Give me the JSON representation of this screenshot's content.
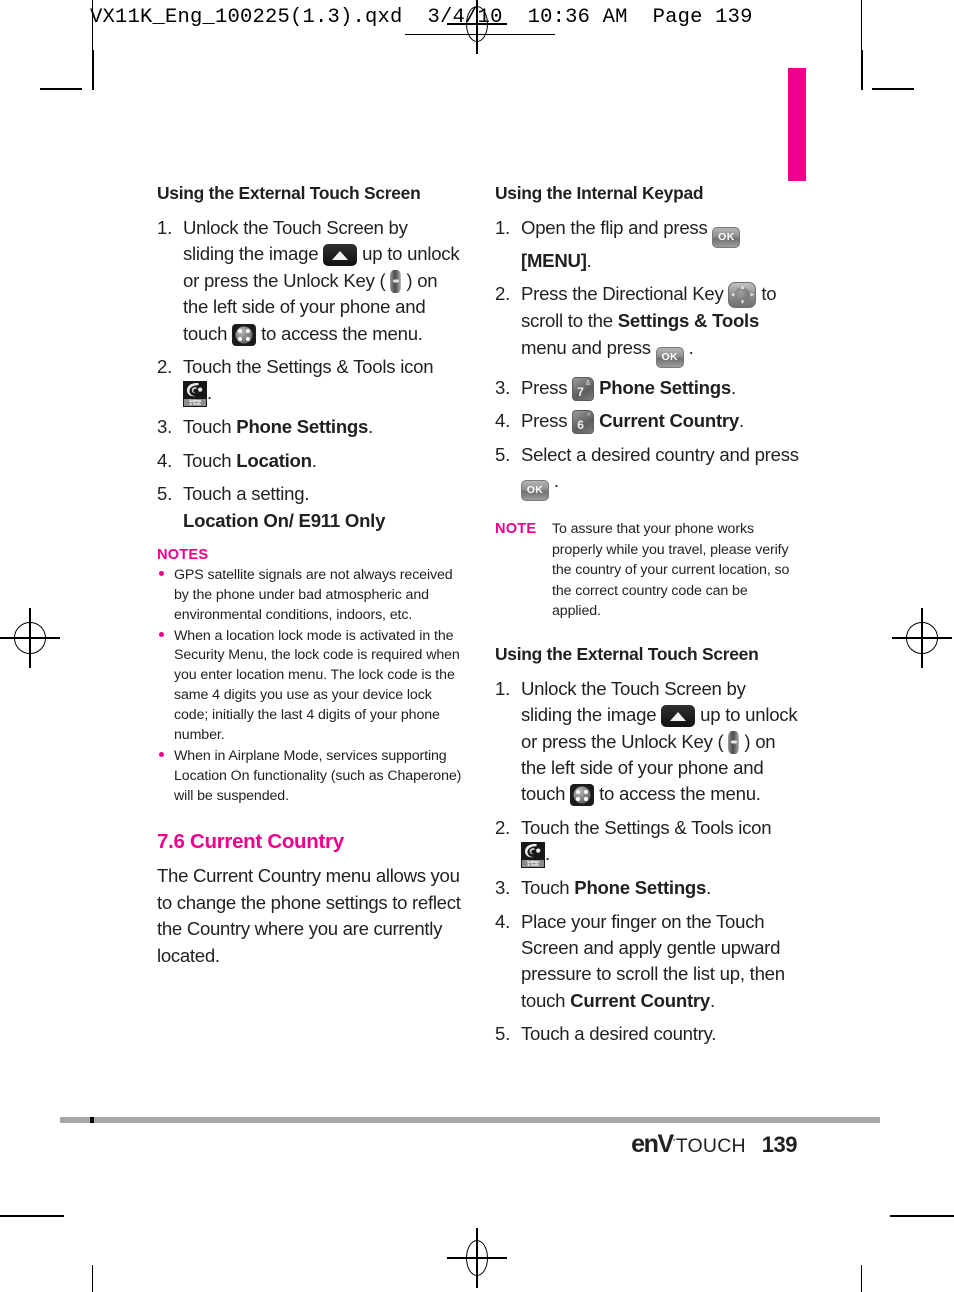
{
  "slug": {
    "text": "VX11K_Eng_100225(1.3).qxd  3/4/10  10:36 AM  Page 139"
  },
  "colors": {
    "accent": "#ec008c",
    "text": "#231f20",
    "footer_rule": "#a7a7a7"
  },
  "left_column": {
    "heading": "Using the External Touch Screen",
    "steps": [
      {
        "num": "1.",
        "parts": [
          {
            "t": "text",
            "v": "Unlock the Touch Screen by sliding the image "
          },
          {
            "t": "icon",
            "v": "slide-up-image-icon"
          },
          {
            "t": "text",
            "v": " up to unlock or press the Unlock Key ( "
          },
          {
            "t": "icon",
            "v": "unlock-key-icon"
          },
          {
            "t": "text",
            "v": " ) on the left side of your phone and touch "
          },
          {
            "t": "icon",
            "v": "menu-dots-icon"
          },
          {
            "t": "text",
            "v": " to access the menu."
          }
        ]
      },
      {
        "num": "2.",
        "parts": [
          {
            "t": "text",
            "v": "Touch the Settings & Tools icon "
          },
          {
            "t": "icon",
            "v": "settings-and-tools-icon"
          },
          {
            "t": "text",
            "v": "."
          }
        ]
      },
      {
        "num": "3.",
        "parts": [
          {
            "t": "text",
            "v": "Touch "
          },
          {
            "t": "bold",
            "v": "Phone Settings"
          },
          {
            "t": "text",
            "v": "."
          }
        ]
      },
      {
        "num": "4.",
        "parts": [
          {
            "t": "text",
            "v": "Touch "
          },
          {
            "t": "bold",
            "v": "Location"
          },
          {
            "t": "text",
            "v": "."
          }
        ]
      },
      {
        "num": "5.",
        "parts": [
          {
            "t": "text",
            "v": "Touch a setting."
          },
          {
            "t": "br",
            "v": ""
          },
          {
            "t": "bold",
            "v": "Location On/ E911 Only"
          }
        ]
      }
    ],
    "notes_heading": "NOTES",
    "notes": [
      "GPS satellite signals are not always received by the phone under bad atmospheric and environmental conditions, indoors, etc.",
      "When a location lock mode is activated in the Security Menu, the lock code is required when you enter location menu. The lock code is the same 4 digits you use as your device lock code; initially the last 4 digits of your phone number.",
      "When in Airplane Mode, services supporting Location On functionality (such as Chaperone) will be suspended."
    ],
    "chapter_heading": "7.6 Current Country",
    "chapter_body": "The Current Country menu allows you to change the phone settings to reflect the Country where you are currently located."
  },
  "right_column": {
    "heading_keypad": "Using the Internal Keypad",
    "keypad_steps": [
      {
        "num": "1.",
        "parts": [
          {
            "t": "text",
            "v": "Open the flip and press "
          },
          {
            "t": "icon",
            "v": "ok-key-icon"
          },
          {
            "t": "text",
            "v": " "
          },
          {
            "t": "bold",
            "v": "[MENU]"
          },
          {
            "t": "text",
            "v": "."
          }
        ]
      },
      {
        "num": "2.",
        "parts": [
          {
            "t": "text",
            "v": "Press the Directional Key "
          },
          {
            "t": "icon",
            "v": "directional-key-icon"
          },
          {
            "t": "text",
            "v": " to scroll to the "
          },
          {
            "t": "bold",
            "v": "Settings & Tools"
          },
          {
            "t": "text",
            "v": " menu and press "
          },
          {
            "t": "icon",
            "v": "ok-key-icon"
          },
          {
            "t": "text",
            "v": " ."
          }
        ]
      },
      {
        "num": "3.",
        "parts": [
          {
            "t": "text",
            "v": "Press "
          },
          {
            "t": "icon",
            "v": "key-7-icon"
          },
          {
            "t": "text",
            "v": " "
          },
          {
            "t": "bold",
            "v": "Phone Settings"
          },
          {
            "t": "text",
            "v": "."
          }
        ]
      },
      {
        "num": "4.",
        "parts": [
          {
            "t": "text",
            "v": "Press "
          },
          {
            "t": "icon",
            "v": "key-6-icon"
          },
          {
            "t": "text",
            "v": " "
          },
          {
            "t": "bold",
            "v": "Current Country"
          },
          {
            "t": "text",
            "v": "."
          }
        ]
      },
      {
        "num": "5.",
        "parts": [
          {
            "t": "text",
            "v": "Select a desired country and press "
          },
          {
            "t": "icon",
            "v": "ok-key-icon"
          },
          {
            "t": "text",
            "v": " ."
          }
        ]
      }
    ],
    "note_label": "NOTE",
    "note_text": "To assure that your phone works properly while you travel, please verify the country of your current location, so the correct country code can be applied.",
    "heading_touch": "Using the External Touch Screen",
    "touch_steps": [
      {
        "num": "1.",
        "parts": [
          {
            "t": "text",
            "v": "Unlock the Touch Screen by sliding the image "
          },
          {
            "t": "icon",
            "v": "slide-up-image-icon"
          },
          {
            "t": "text",
            "v": " up to unlock or press the Unlock Key ( "
          },
          {
            "t": "icon",
            "v": "unlock-key-icon"
          },
          {
            "t": "text",
            "v": " ) on the left side of your phone and touch "
          },
          {
            "t": "icon",
            "v": "menu-dots-icon"
          },
          {
            "t": "text",
            "v": " to access the menu."
          }
        ]
      },
      {
        "num": "2.",
        "parts": [
          {
            "t": "text",
            "v": "Touch the Settings & Tools icon "
          },
          {
            "t": "icon",
            "v": "settings-and-tools-icon"
          },
          {
            "t": "text",
            "v": "."
          }
        ]
      },
      {
        "num": "3.",
        "parts": [
          {
            "t": "text",
            "v": "Touch "
          },
          {
            "t": "bold",
            "v": "Phone Settings"
          },
          {
            "t": "text",
            "v": "."
          }
        ]
      },
      {
        "num": "4.",
        "parts": [
          {
            "t": "text",
            "v": "Place your finger on the Touch Screen and apply gentle upward pressure to scroll the list up, then touch "
          },
          {
            "t": "bold",
            "v": "Current Country"
          },
          {
            "t": "text",
            "v": "."
          }
        ]
      },
      {
        "num": "5.",
        "parts": [
          {
            "t": "text",
            "v": "Touch a desired country."
          }
        ]
      }
    ]
  },
  "icons": {
    "settings_label_line1": "Settings",
    "settings_label_line2": "& Tools",
    "ok_label": "OK",
    "key7_num": "7",
    "key7_sym": "&",
    "key6_num": "6",
    "key6_sym": "^"
  },
  "footer": {
    "logo_env": "enV",
    "logo_tm": "·",
    "logo_touch": "TOUCH",
    "page_number": "139"
  }
}
